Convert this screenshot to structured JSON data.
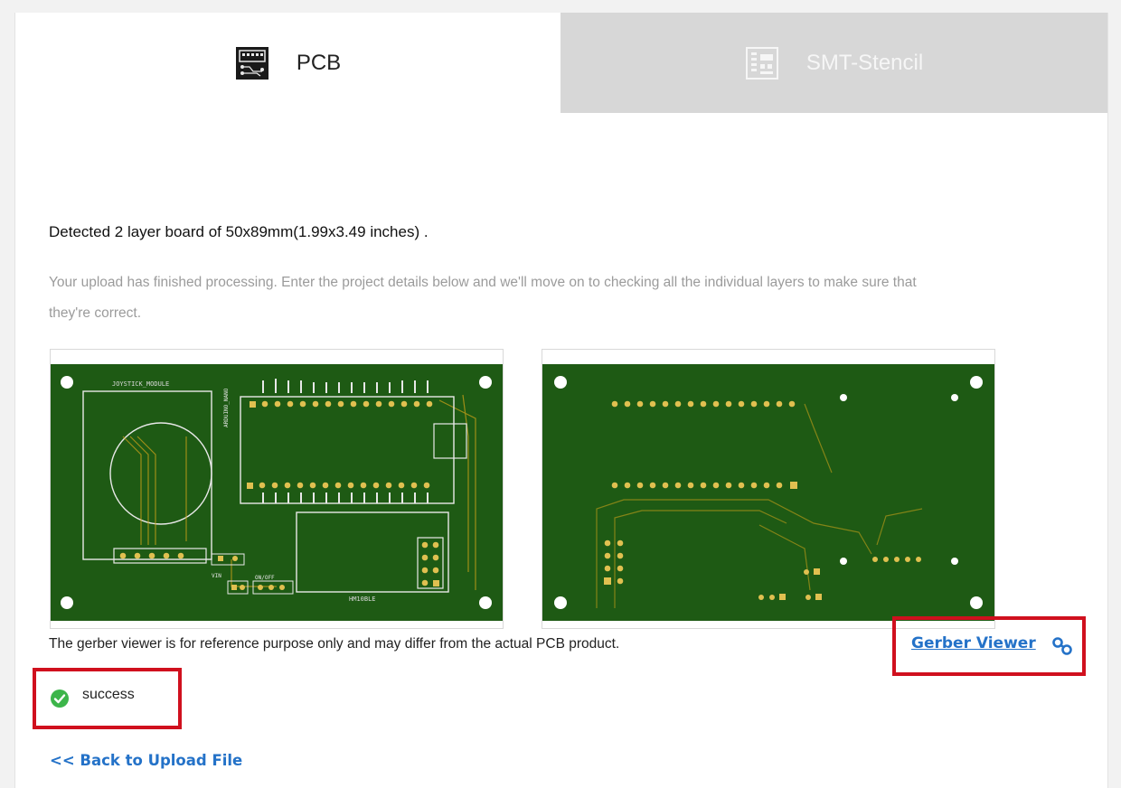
{
  "tabs": {
    "pcb": {
      "label": "PCB",
      "icon": "pcb-board-icon"
    },
    "stencil": {
      "label": "SMT-Stencil",
      "icon": "stencil-icon"
    }
  },
  "detected_text": "Detected 2 layer board of 50x89mm(1.99x3.49 inches) .",
  "info_text": "Your upload has finished processing. Enter the project details below and we'll move on to checking all the individual layers to make sure that they're correct.",
  "pcb_top": {
    "silkscreen_title": "JOYSTICK_MODULE",
    "module_label": "HM10BLE",
    "switch_label": "ON/OFF",
    "power_label": "VIN",
    "vertical_label": "ARDUINO_NANO"
  },
  "disclaimer": "The gerber viewer is for reference purpose only and may differ from the actual PCB product.",
  "gerber_viewer_label": "Gerber Viewer",
  "status": {
    "text": "success",
    "icon": "check-circle-icon"
  },
  "back_link_label": "<< Back to Upload File",
  "colors": {
    "pcb_green": "#1e5a14",
    "accent_link": "#2472c8",
    "highlight_red": "#d0101e",
    "success_green": "#3cb54a",
    "inactive_tab": "#d7d7d7"
  }
}
